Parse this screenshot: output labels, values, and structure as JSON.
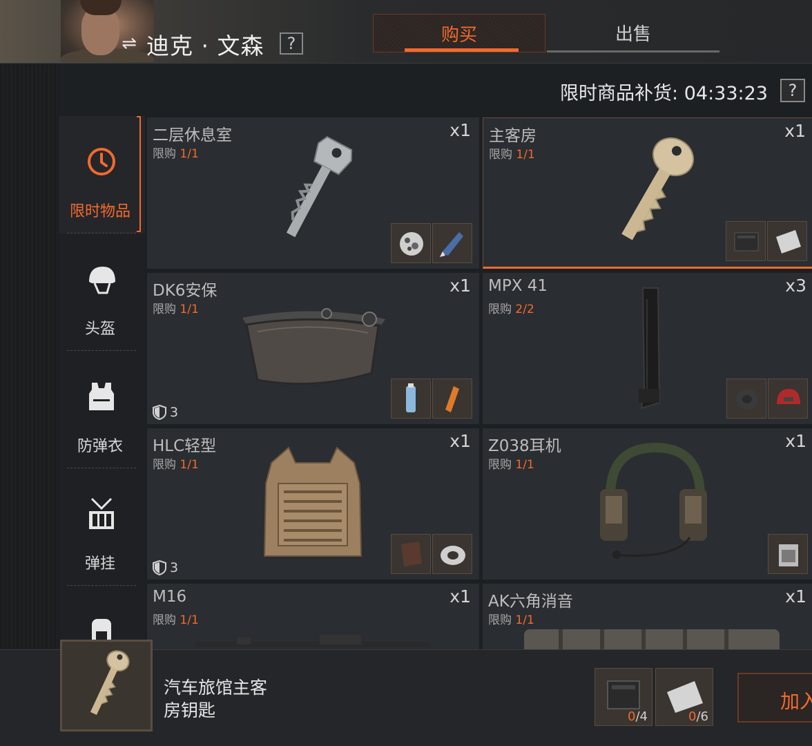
{
  "header": {
    "trader_name": "迪克 · 文森",
    "help_label": "?",
    "tabs": {
      "buy": "购买",
      "sell": "出售"
    }
  },
  "restock": {
    "label": "限时商品补货: 04:33:23",
    "help_label": "?"
  },
  "categories": [
    {
      "label": "限时物品",
      "icon": "clock-icon",
      "active": true
    },
    {
      "label": "头盔",
      "icon": "helmet-icon"
    },
    {
      "label": "防弹衣",
      "icon": "vest-icon"
    },
    {
      "label": "弹挂",
      "icon": "chest-rig-icon"
    },
    {
      "label": "",
      "icon": "backpack-icon"
    }
  ],
  "items": [
    {
      "name": "二层休息室",
      "limit_prefix": "限购",
      "limit": "1/1",
      "qty": "x1",
      "art": "silver-key-icon"
    },
    {
      "name": "主客房",
      "limit_prefix": "限购",
      "limit": "1/1",
      "qty": "x1",
      "art": "brass-key-icon",
      "selected": true
    },
    {
      "name": "DK6安保",
      "limit_prefix": "限购",
      "limit": "1/1",
      "qty": "x1",
      "armor": "3",
      "art": "face-shield-icon"
    },
    {
      "name": "MPX 41",
      "limit_prefix": "限购",
      "limit": "2/2",
      "qty": "x3",
      "art": "magazine-icon"
    },
    {
      "name": "HLC轻型",
      "limit_prefix": "限购",
      "limit": "1/1",
      "qty": "x1",
      "armor": "3",
      "art": "plate-carrier-icon"
    },
    {
      "name": "Z038耳机",
      "limit_prefix": "限购",
      "limit": "1/1",
      "qty": "x1",
      "art": "headset-icon"
    },
    {
      "name": "M16",
      "limit_prefix": "限购",
      "limit": "1/1",
      "qty": "x1",
      "art": "rifle-icon"
    },
    {
      "name": "AK六角消音",
      "limit_prefix": "限购",
      "limit": "1/1",
      "qty": "x1",
      "art": "suppressor-icon"
    }
  ],
  "selected": {
    "name_line1": "汽车旅馆主客",
    "name_line2": "房钥匙",
    "requirements": [
      {
        "have": "0",
        "need": "/4",
        "icon": "black-box-icon"
      },
      {
        "have": "0",
        "need": "/6",
        "icon": "paper-icon"
      }
    ],
    "add_label": "加入"
  },
  "colors": {
    "accent": "#f26a2e",
    "panel": "#2a2d31",
    "background": "#1d2023"
  }
}
